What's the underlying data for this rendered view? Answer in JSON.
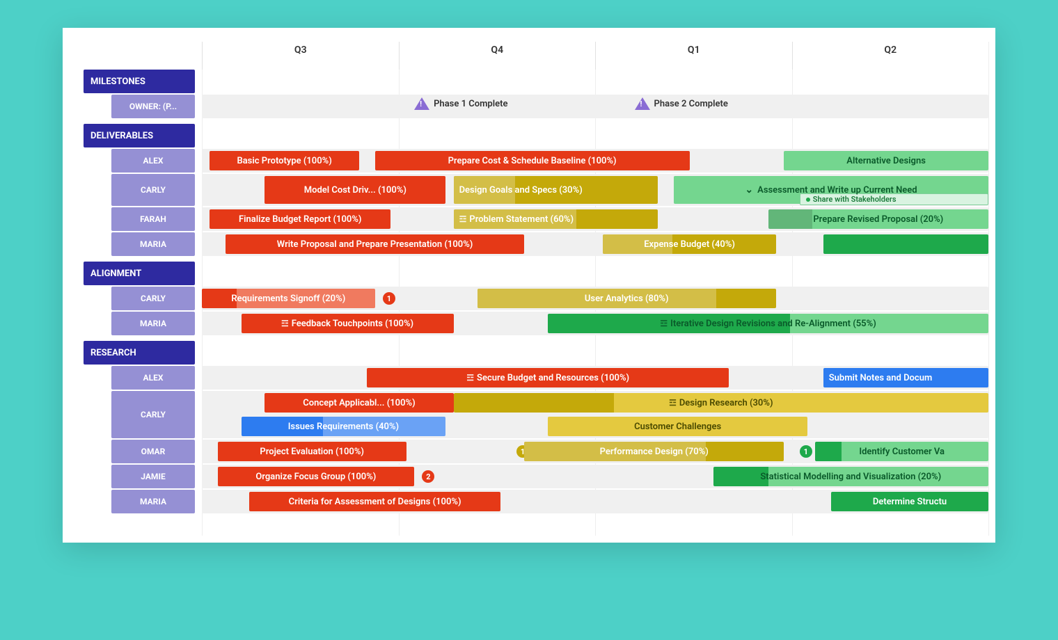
{
  "chart_data": {
    "type": "gantt",
    "x_axis": [
      "Q3",
      "Q4",
      "Q1",
      "Q2"
    ],
    "sections": [
      {
        "name": "MILESTONES",
        "rows": [
          {
            "owner": "OWNER: (P...",
            "milestones": [
              {
                "label": "Phase 1 Complete",
                "pos": 27
              },
              {
                "label": "Phase 2 Complete",
                "pos": 55
              }
            ]
          }
        ]
      },
      {
        "name": "DELIVERABLES",
        "rows": [
          {
            "owner": "ALEX",
            "bars": [
              {
                "label": "Basic Prototype (100%)",
                "start": 1,
                "end": 20,
                "color": "c-red",
                "progress": 100
              },
              {
                "label": "Prepare Cost & Schedule Baseline (100%)",
                "start": 22,
                "end": 62,
                "color": "c-red",
                "progress": 100
              },
              {
                "label": "Alternative Designs",
                "start": 74,
                "end": 100,
                "color": "c-green-l",
                "progress": 0
              }
            ]
          },
          {
            "owner": "CARLY",
            "bars": [
              {
                "label": "Model Cost Driv... (100%)",
                "start": 8,
                "end": 31,
                "color": "c-red",
                "progress": 100
              },
              {
                "label": "Design Goals and Specs (30%)",
                "start": 32,
                "end": 58,
                "color": "c-olive",
                "progress": 30,
                "light": true,
                "leftAlign": true
              },
              {
                "label": "Assessment and Write up Current Need",
                "start": 60,
                "end": 100,
                "color": "c-green-l",
                "progress": 0,
                "chevron": true,
                "subtask": {
                  "label": "Share with Stakeholders",
                  "start": 76,
                  "end": 100
                }
              }
            ]
          },
          {
            "owner": "FARAH",
            "bars": [
              {
                "label": "Finalize Budget Report (100%)",
                "start": 1,
                "end": 24,
                "color": "c-red",
                "progress": 100
              },
              {
                "label": "Problem Statement (60%)",
                "start": 32,
                "end": 58,
                "color": "c-olive",
                "progress": 60,
                "light": true,
                "icon": true,
                "leftAlign": true
              },
              {
                "label": "Prepare Revised Proposal (20%)",
                "start": 72,
                "end": 100,
                "color": "c-green-l",
                "progress": 20
              }
            ]
          },
          {
            "owner": "MARIA",
            "bars": [
              {
                "label": "Write Proposal and Prepare Presentation (100%)",
                "start": 3,
                "end": 41,
                "color": "c-red",
                "progress": 100
              },
              {
                "label": "Expense Budget (40%)",
                "start": 51,
                "end": 73,
                "color": "c-olive",
                "progress": 40,
                "light": true
              },
              {
                "label": "",
                "start": 79,
                "end": 100,
                "color": "c-green",
                "progress": 0
              }
            ]
          }
        ]
      },
      {
        "name": "ALIGNMENT",
        "rows": [
          {
            "owner": "CARLY",
            "bars": [
              {
                "label": "Requirements Signoff (20%)",
                "start": 0,
                "end": 22,
                "color": "c-red-l",
                "progress": 20,
                "prog_dark": true,
                "badge": {
                  "n": "1",
                  "color": "#e53917",
                  "pos": 23
                }
              },
              {
                "label": "User Analytics (80%)",
                "start": 35,
                "end": 73,
                "color": "c-olive",
                "progress": 80,
                "light": true
              }
            ]
          },
          {
            "owner": "MARIA",
            "bars": [
              {
                "label": "Feedback Touchpoints (100%)",
                "start": 5,
                "end": 32,
                "color": "c-red",
                "progress": 100,
                "icon": true
              },
              {
                "label": "Iterative Design Revisions and Re-Alignment (55%)",
                "start": 44,
                "end": 100,
                "color": "c-green-l",
                "progress": 55,
                "icon": true,
                "prog_green": true
              }
            ]
          }
        ]
      },
      {
        "name": "RESEARCH",
        "rows": [
          {
            "owner": "ALEX",
            "bars": [
              {
                "label": "Secure Budget and Resources (100%)",
                "start": 21,
                "end": 67,
                "color": "c-red",
                "progress": 100,
                "icon": true
              },
              {
                "label": "Submit Notes and Docum",
                "start": 79,
                "end": 100,
                "color": "c-blue",
                "progress": 0,
                "leftAlign": true
              }
            ]
          },
          {
            "owner": "CARLY",
            "double": true,
            "bars": [
              {
                "label": "Concept Applicabl... (100%)",
                "start": 8,
                "end": 32,
                "color": "c-red",
                "progress": 100,
                "sub": 0
              },
              {
                "label": "Design Research (30%)",
                "start": 32,
                "end": 100,
                "color": "c-yellow",
                "progress": 30,
                "icon": true,
                "sub": 0,
                "prog_olive": true
              },
              {
                "label": "Issues Requirements (40%)",
                "start": 5,
                "end": 31,
                "color": "c-blue-l",
                "progress": 40,
                "sub": 1,
                "prog_blue": true
              },
              {
                "label": "Customer Challenges",
                "start": 44,
                "end": 77,
                "color": "c-yellow",
                "progress": 0,
                "sub": 1
              }
            ]
          },
          {
            "owner": "OMAR",
            "bars": [
              {
                "label": "Project Evaluation (100%)",
                "start": 2,
                "end": 26,
                "color": "c-red",
                "progress": 100,
                "badge": {
                  "n": "1",
                  "color": "#c4a90a",
                  "pos": 40
                }
              },
              {
                "label": "Performance Design (70%)",
                "start": 41,
                "end": 74,
                "color": "c-olive",
                "progress": 70,
                "light": true,
                "badge": {
                  "n": "1",
                  "color": "#1ea94b",
                  "pos": 76
                }
              },
              {
                "label": "Identify Customer Va",
                "start": 78,
                "end": 100,
                "color": "c-green-l",
                "progress": 0,
                "prog_green": true,
                "progress2": 15
              }
            ]
          },
          {
            "owner": "JAMIE",
            "bars": [
              {
                "label": "Organize Focus Group (100%)",
                "start": 2,
                "end": 27,
                "color": "c-red",
                "progress": 100,
                "badge": {
                  "n": "2",
                  "color": "#e53917",
                  "pos": 28
                }
              },
              {
                "label": "Statistical Modelling and Visualization (20%)",
                "start": 65,
                "end": 100,
                "color": "c-green-l",
                "progress": 20,
                "prog_green": true
              }
            ]
          },
          {
            "owner": "MARIA",
            "bars": [
              {
                "label": "Criteria for Assessment of Designs (100%)",
                "start": 6,
                "end": 38,
                "color": "c-red",
                "progress": 100
              },
              {
                "label": "Determine Structu",
                "start": 80,
                "end": 100,
                "color": "c-green",
                "progress": 0
              }
            ]
          }
        ]
      }
    ]
  }
}
